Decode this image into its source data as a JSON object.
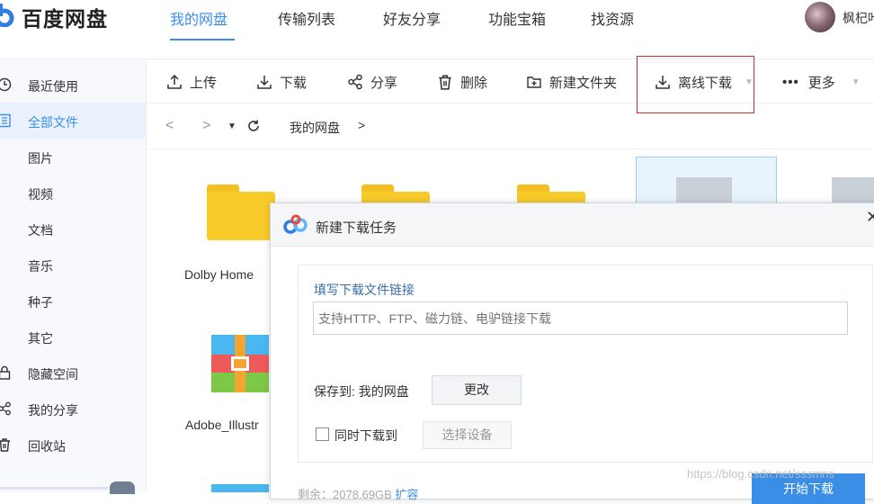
{
  "app": {
    "name": "百度网盘"
  },
  "topnav": {
    "items": [
      {
        "label": "我的网盘",
        "active": true
      },
      {
        "label": "传输列表"
      },
      {
        "label": "好友分享"
      },
      {
        "label": "功能宝箱"
      },
      {
        "label": "找资源"
      }
    ],
    "username": "枫杞叶"
  },
  "sidebar": {
    "items": [
      {
        "label": "最近使用",
        "icon": "clock-icon"
      },
      {
        "label": "全部文件",
        "icon": "file-list-icon",
        "active": true
      },
      {
        "label": "图片"
      },
      {
        "label": "视频"
      },
      {
        "label": "文档"
      },
      {
        "label": "音乐"
      },
      {
        "label": "种子"
      },
      {
        "label": "其它"
      },
      {
        "label": "隐藏空间",
        "icon": "lock-icon"
      },
      {
        "label": "我的分享",
        "icon": "share-icon"
      },
      {
        "label": "回收站",
        "icon": "trash-icon"
      }
    ]
  },
  "toolbar": {
    "upload": "上传",
    "download": "下载",
    "share": "分享",
    "delete": "删除",
    "new_folder": "新建文件夹",
    "offline_download": "离线下载",
    "more": "更多"
  },
  "breadcrumb": {
    "root": "我的网盘",
    "separator": ">"
  },
  "files": [
    {
      "name": "Dolby Home",
      "type": "folder"
    },
    {
      "name": "",
      "type": "folder"
    },
    {
      "name": "",
      "type": "folder"
    },
    {
      "name": "",
      "type": "file",
      "selected": true
    },
    {
      "name": "",
      "type": "file"
    },
    {
      "name": "Adobe_Illustr",
      "type": "winrar"
    }
  ],
  "dialog": {
    "title": "新建下载任务",
    "link_label": "填写下载文件链接",
    "link_placeholder": "支持HTTP、FTP、磁力链、电驴链接下载",
    "save_to_label": "保存到: 我的网盘",
    "change_button": "更改",
    "sync_label": "同时下载到",
    "select_device_button": "选择设备",
    "remaining": "剩余：2078.69GB",
    "expand_link": "扩容",
    "start_button": "开始下载"
  },
  "watermark": "https://blog.csdn.net/sssmns",
  "colors": {
    "accent": "#3a8ee6",
    "folder": "#f8cb2a",
    "highlight": "#c9302c"
  }
}
